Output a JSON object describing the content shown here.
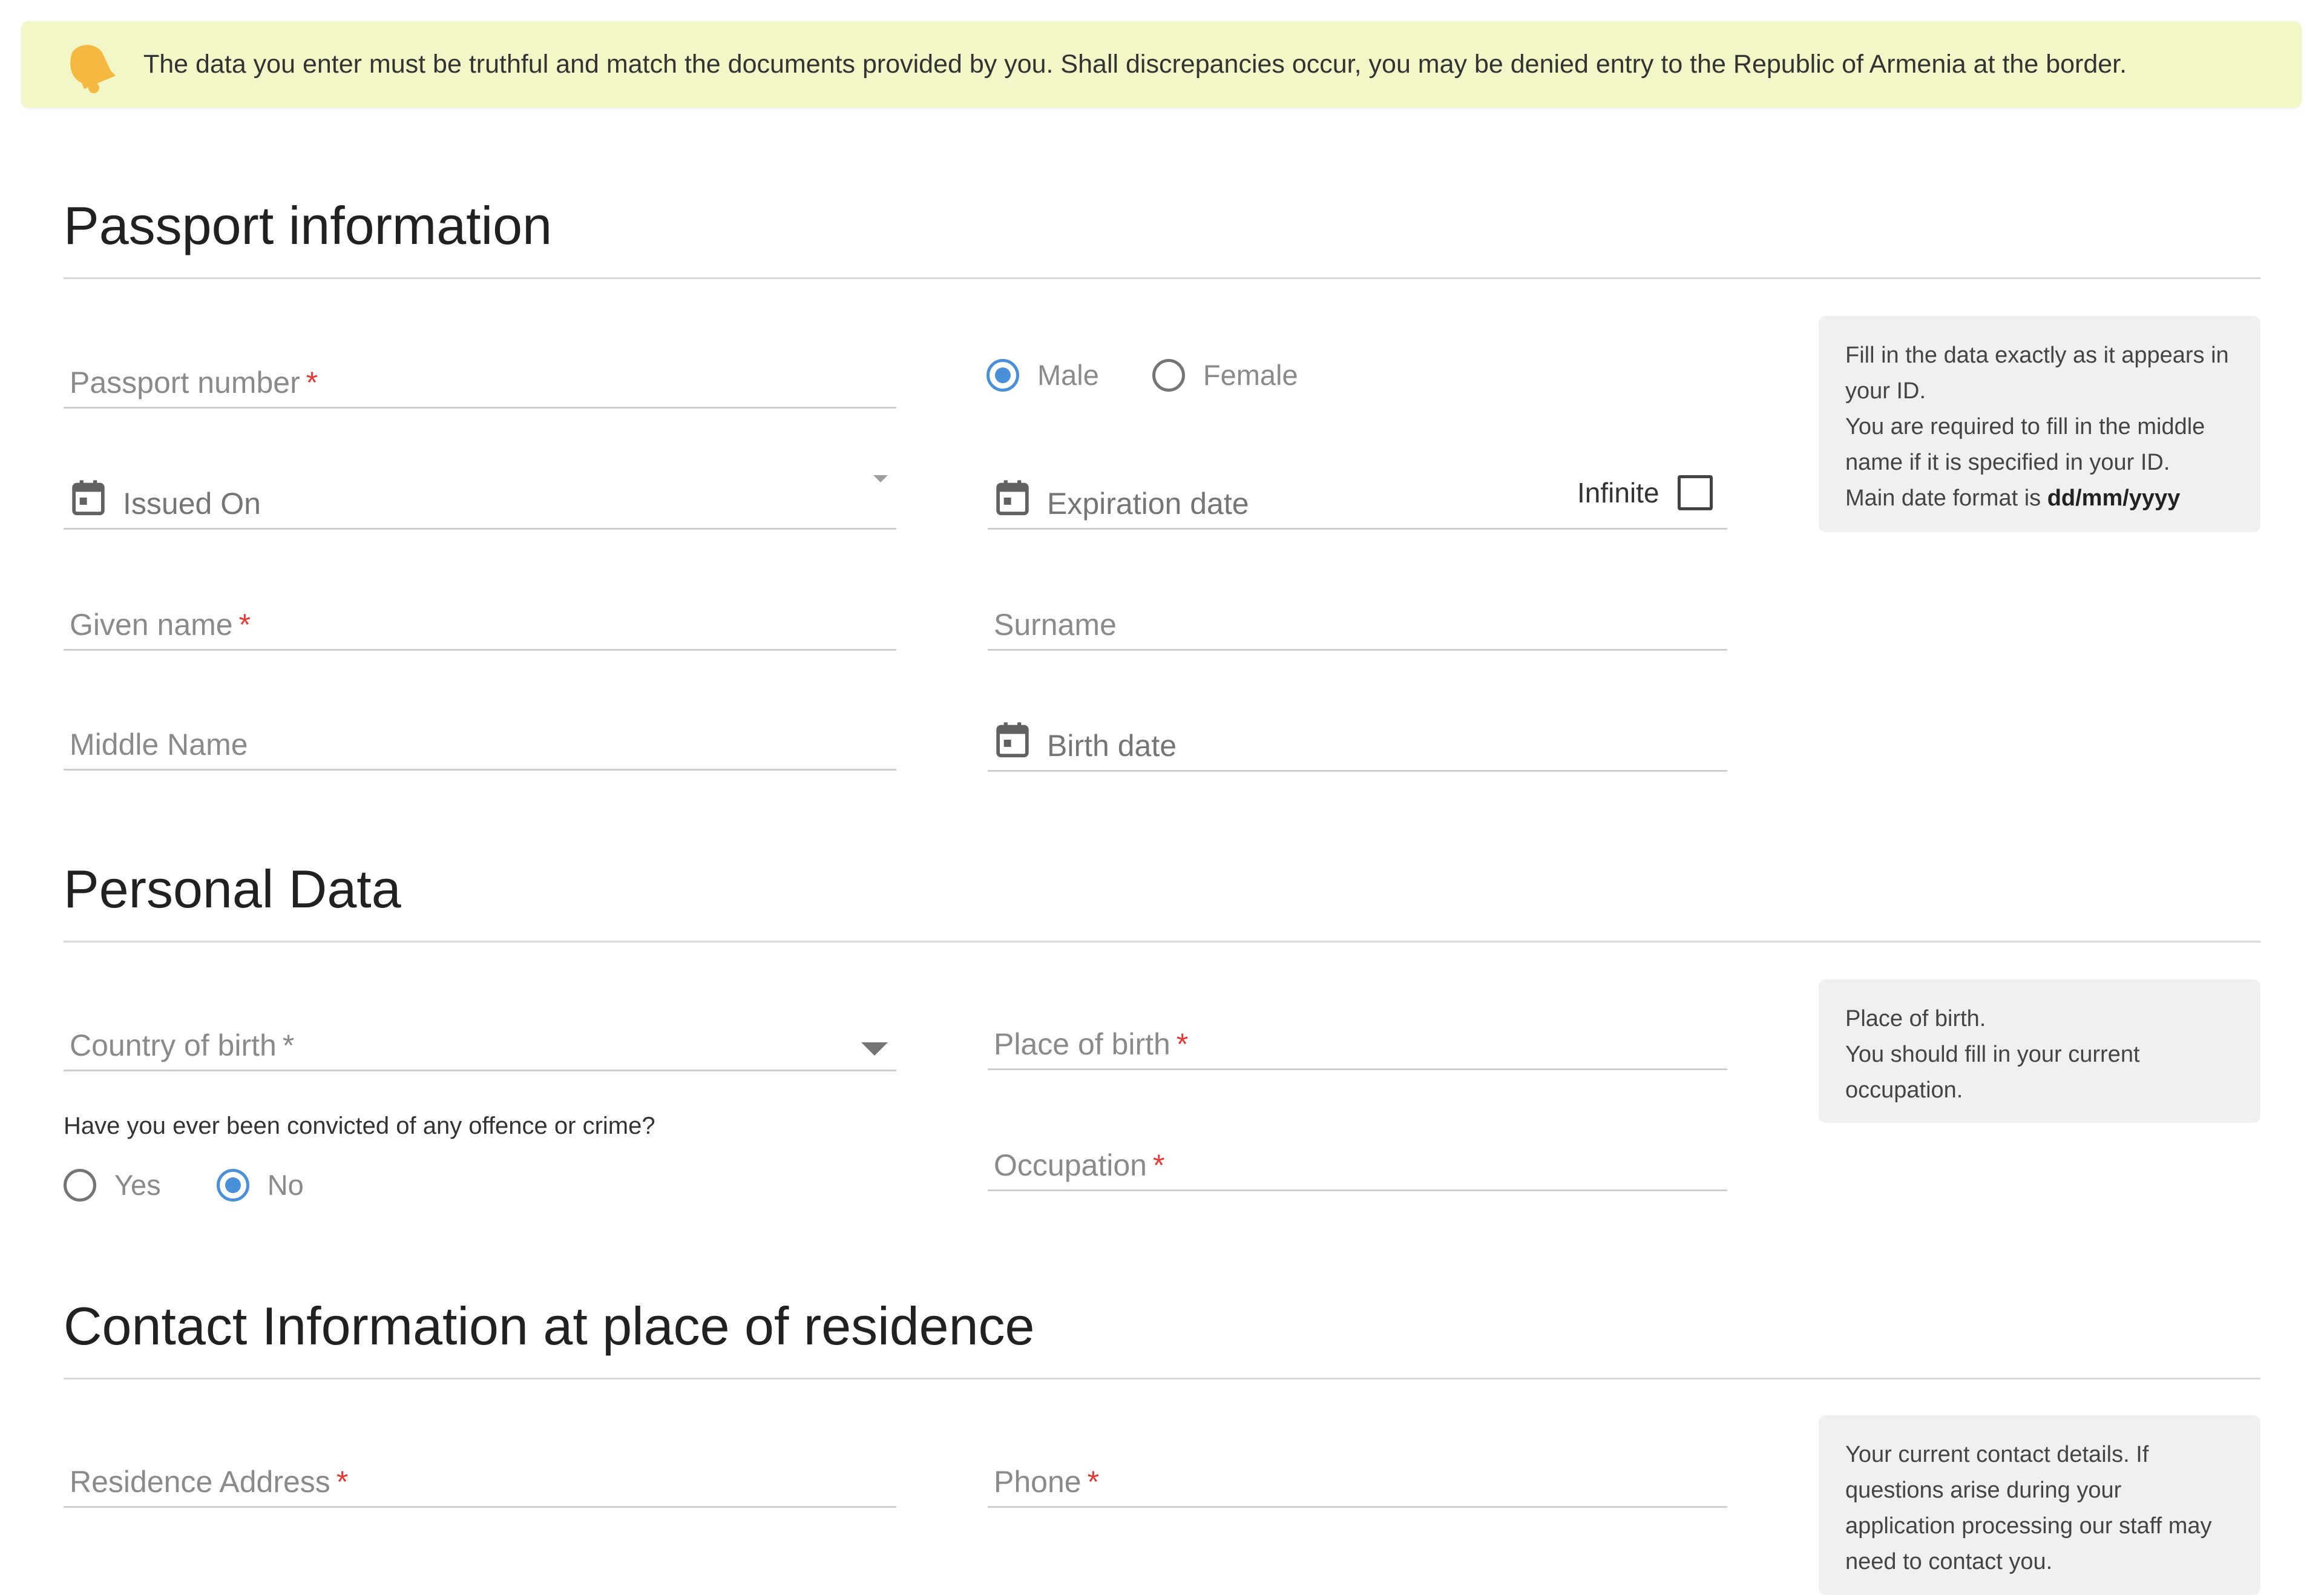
{
  "banner": {
    "icon": "bell-icon",
    "text": "The data you enter must be truthful and match the documents provided by you. Shall discrepancies occur, you may be denied entry to the Republic of Armenia at the border."
  },
  "passport": {
    "title": "Passport information",
    "passport_number": {
      "label": "Passport number",
      "required": "*"
    },
    "gender": {
      "male": "Male",
      "female": "Female",
      "selected": "Male"
    },
    "issued_on": {
      "label": "Issued On"
    },
    "expiration_date": {
      "label": "Expiration date"
    },
    "infinite_label": "Infinite",
    "given_name": {
      "label": "Given name",
      "required": "*"
    },
    "surname": {
      "label": "Surname"
    },
    "middle_name": {
      "label": "Middle Name"
    },
    "birth_date": {
      "label": "Birth date"
    },
    "info": {
      "line1": "Fill in the data exactly as it appears in your ID.",
      "line2": "You are required to fill in the middle name if it is specified in your ID.",
      "line3_prefix": "Main date format is ",
      "line3_format": "dd/mm/yyyy"
    }
  },
  "personal": {
    "title": "Personal Data",
    "country_of_birth": {
      "label": "Country of birth",
      "required": "*"
    },
    "place_of_birth": {
      "label": "Place of birth",
      "required": "*"
    },
    "occupation": {
      "label": "Occupation",
      "required": "*"
    },
    "conviction_question": "Have you ever been convicted of any offence or crime?",
    "conviction": {
      "yes": "Yes",
      "no": "No",
      "selected": "No"
    },
    "info": {
      "line1": "Place of birth.",
      "line2": "You should fill in your current occupation."
    }
  },
  "contact": {
    "title": "Contact Information at place of residence",
    "residence_address": {
      "label": "Residence Address",
      "required": "*"
    },
    "phone": {
      "label": "Phone",
      "required": "*"
    },
    "info": {
      "text": "Your current contact details. If questions arise during your application processing our staff may need to contact you."
    }
  },
  "colors": {
    "banner_bg": "#f3f7c8",
    "bell": "#f5b942",
    "accent": "#4a90d9",
    "required": "#e53935",
    "info_bg": "#f0f0f0"
  }
}
